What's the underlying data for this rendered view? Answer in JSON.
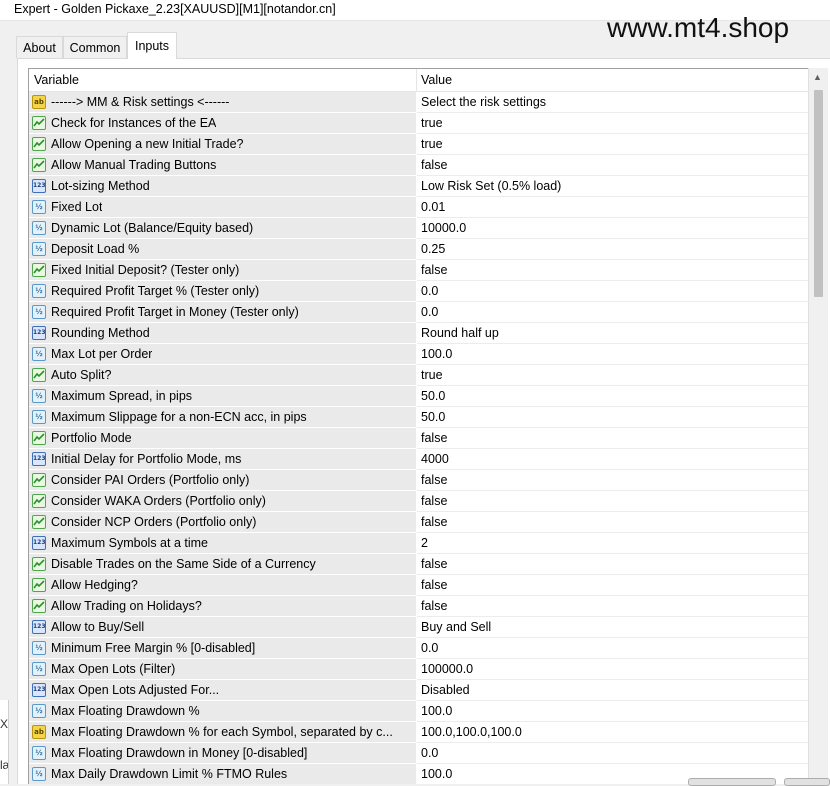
{
  "window": {
    "title": "Expert - Golden Pickaxe_2.23[XAUUSD][M1][notandor.cn]"
  },
  "watermark": "www.mt4.shop",
  "tabs": [
    {
      "label": "About",
      "active": false
    },
    {
      "label": "Common",
      "active": false
    },
    {
      "label": "Inputs",
      "active": true
    }
  ],
  "table": {
    "headers": {
      "variable": "Variable",
      "value": "Value"
    },
    "rows": [
      {
        "type": "ab",
        "icon": "string-icon",
        "name": "------> MM & Risk settings <------",
        "value": "Select the risk settings"
      },
      {
        "type": "bool",
        "icon": "bool-icon",
        "name": "Check for Instances of the EA",
        "value": "true"
      },
      {
        "type": "bool",
        "icon": "bool-icon",
        "name": "Allow Opening a new Initial Trade?",
        "value": "true"
      },
      {
        "type": "bool",
        "icon": "bool-icon",
        "name": "Allow Manual Trading Buttons",
        "value": "false"
      },
      {
        "type": "num",
        "icon": "integer-icon",
        "name": "Lot-sizing Method",
        "value": "Low Risk Set (0.5% load)"
      },
      {
        "type": "dbl",
        "icon": "double-icon",
        "name": "Fixed Lot",
        "value": "0.01"
      },
      {
        "type": "dbl",
        "icon": "double-icon",
        "name": "Dynamic Lot (Balance/Equity based)",
        "value": "10000.0"
      },
      {
        "type": "dbl",
        "icon": "double-icon",
        "name": "Deposit Load %",
        "value": "0.25"
      },
      {
        "type": "bool",
        "icon": "bool-icon",
        "name": "Fixed Initial Deposit? (Tester only)",
        "value": "false"
      },
      {
        "type": "dbl",
        "icon": "double-icon",
        "name": "Required Profit Target % (Tester only)",
        "value": "0.0"
      },
      {
        "type": "dbl",
        "icon": "double-icon",
        "name": "Required Profit Target in Money (Tester only)",
        "value": "0.0"
      },
      {
        "type": "num",
        "icon": "integer-icon",
        "name": "Rounding Method",
        "value": "Round half up"
      },
      {
        "type": "dbl",
        "icon": "double-icon",
        "name": "Max Lot per Order",
        "value": "100.0"
      },
      {
        "type": "bool",
        "icon": "bool-icon",
        "name": "Auto Split?",
        "value": "true"
      },
      {
        "type": "dbl",
        "icon": "double-icon",
        "name": "Maximum Spread, in pips",
        "value": "50.0"
      },
      {
        "type": "dbl",
        "icon": "double-icon",
        "name": "Maximum Slippage for a non-ECN acc, in pips",
        "value": "50.0"
      },
      {
        "type": "bool",
        "icon": "bool-icon",
        "name": "Portfolio Mode",
        "value": "false"
      },
      {
        "type": "num",
        "icon": "integer-icon",
        "name": "Initial Delay for Portfolio Mode, ms",
        "value": "4000"
      },
      {
        "type": "bool",
        "icon": "bool-icon",
        "name": "Consider PAI Orders (Portfolio only)",
        "value": "false"
      },
      {
        "type": "bool",
        "icon": "bool-icon",
        "name": "Consider WAKA Orders (Portfolio only)",
        "value": "false"
      },
      {
        "type": "bool",
        "icon": "bool-icon",
        "name": "Consider NCP Orders (Portfolio only)",
        "value": "false"
      },
      {
        "type": "num",
        "icon": "integer-icon",
        "name": "Maximum Symbols at a time",
        "value": "2"
      },
      {
        "type": "bool",
        "icon": "bool-icon",
        "name": "Disable Trades on the Same Side of a Currency",
        "value": "false"
      },
      {
        "type": "bool",
        "icon": "bool-icon",
        "name": "Allow Hedging?",
        "value": "false"
      },
      {
        "type": "bool",
        "icon": "bool-icon",
        "name": "Allow Trading on Holidays?",
        "value": "false"
      },
      {
        "type": "num",
        "icon": "integer-icon",
        "name": "Allow to Buy/Sell",
        "value": "Buy and Sell"
      },
      {
        "type": "dbl",
        "icon": "double-icon",
        "name": "Minimum Free Margin % [0-disabled]",
        "value": "0.0"
      },
      {
        "type": "dbl",
        "icon": "double-icon",
        "name": "Max Open Lots (Filter)",
        "value": "100000.0"
      },
      {
        "type": "num",
        "icon": "integer-icon",
        "name": "Max Open Lots Adjusted For...",
        "value": "Disabled"
      },
      {
        "type": "dbl",
        "icon": "double-icon",
        "name": "Max Floating Drawdown %",
        "value": "100.0"
      },
      {
        "type": "ab",
        "icon": "string-icon",
        "name": "Max Floating Drawdown % for each Symbol, separated by c...",
        "value": "100.0,100.0,100.0"
      },
      {
        "type": "dbl",
        "icon": "double-icon",
        "name": "Max Floating Drawdown in Money [0-disabled]",
        "value": "0.0"
      },
      {
        "type": "dbl",
        "icon": "double-icon",
        "name": "Max Daily Drawdown Limit % FTMO Rules",
        "value": "100.0"
      }
    ]
  },
  "icon_glyphs": {
    "ab": "ab",
    "num": "123",
    "dbl": "½"
  },
  "left_strip_glyphs": [
    "X",
    "læ"
  ],
  "colors": {
    "row_label_bg": "#eaeaea",
    "window_bg": "#f0f0f0",
    "scroll_thumb": "#c1c1c1"
  }
}
